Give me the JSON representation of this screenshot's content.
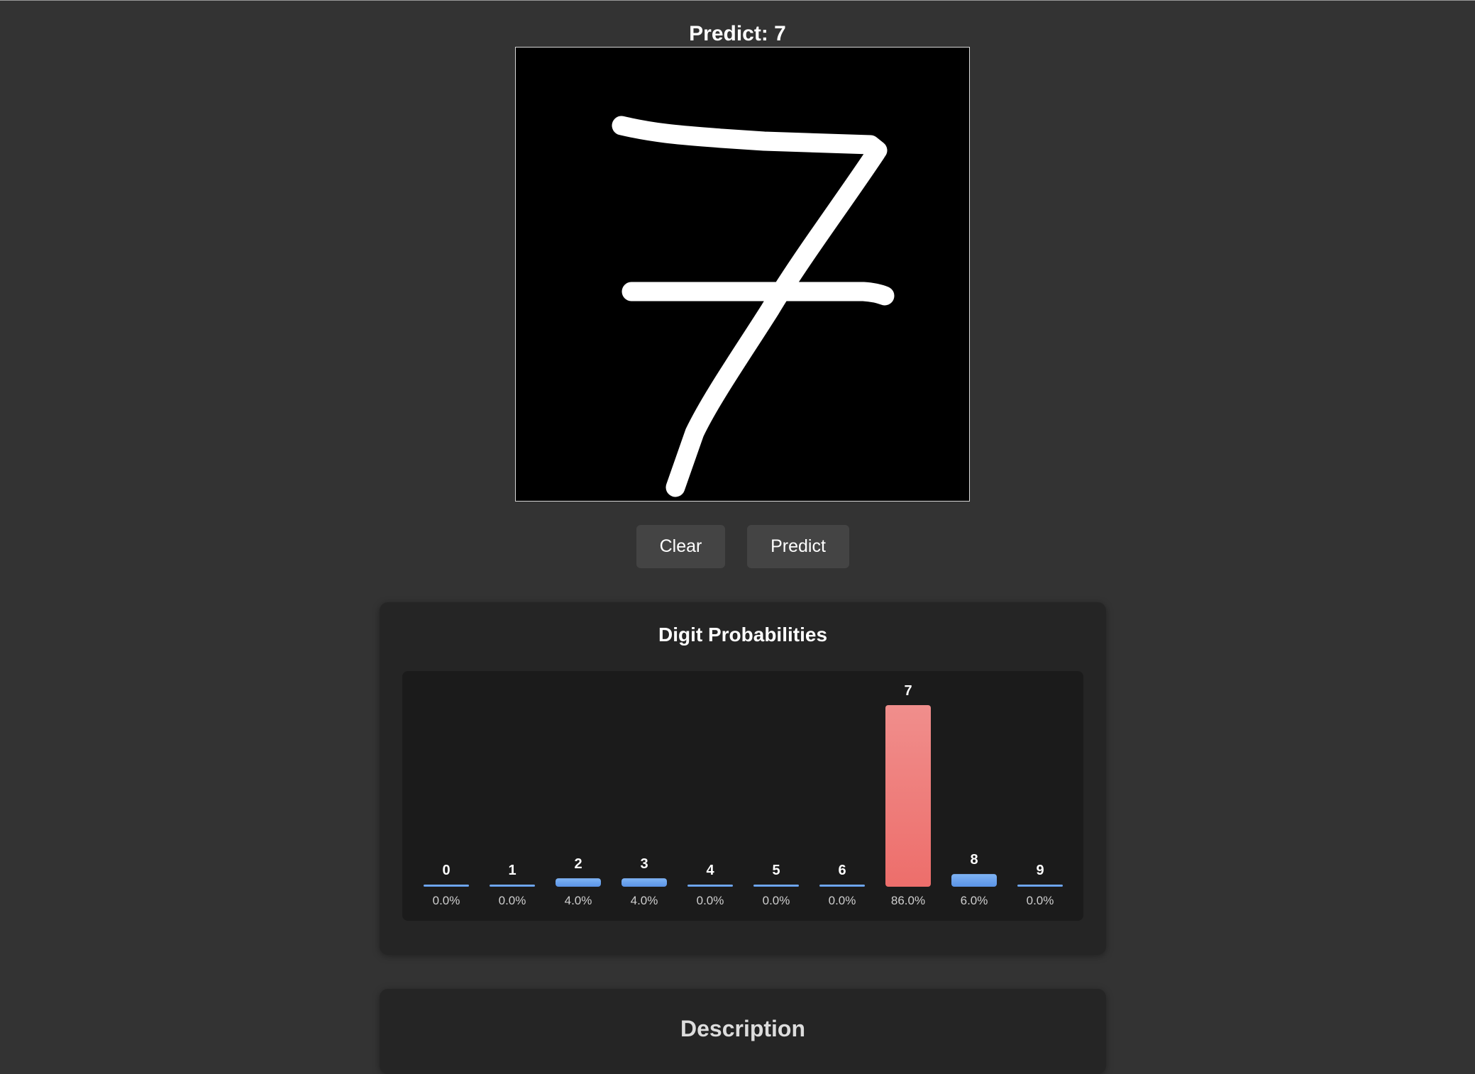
{
  "header": {
    "prediction_title": "Predict: 7"
  },
  "drawing": {
    "description": "handwritten digit seven on black canvas"
  },
  "buttons": {
    "clear_label": "Clear",
    "predict_label": "Predict"
  },
  "probabilities_panel": {
    "title": "Digit Probabilities"
  },
  "description_panel": {
    "title": "Description"
  },
  "colors": {
    "bar_default": "#6aa6f0",
    "bar_predicted": "#ee7b78",
    "background": "#333333"
  },
  "chart_data": {
    "type": "bar",
    "categories": [
      "0",
      "1",
      "2",
      "3",
      "4",
      "5",
      "6",
      "7",
      "8",
      "9"
    ],
    "values": [
      0.0,
      0.0,
      4.0,
      4.0,
      0.0,
      0.0,
      0.0,
      86.0,
      6.0,
      0.0
    ],
    "value_labels": [
      "0.0%",
      "0.0%",
      "4.0%",
      "4.0%",
      "0.0%",
      "0.0%",
      "0.0%",
      "86.0%",
      "6.0%",
      "0.0%"
    ],
    "highlighted_category": "7",
    "ylim": [
      0,
      86
    ],
    "grid": false,
    "legend": "none"
  }
}
